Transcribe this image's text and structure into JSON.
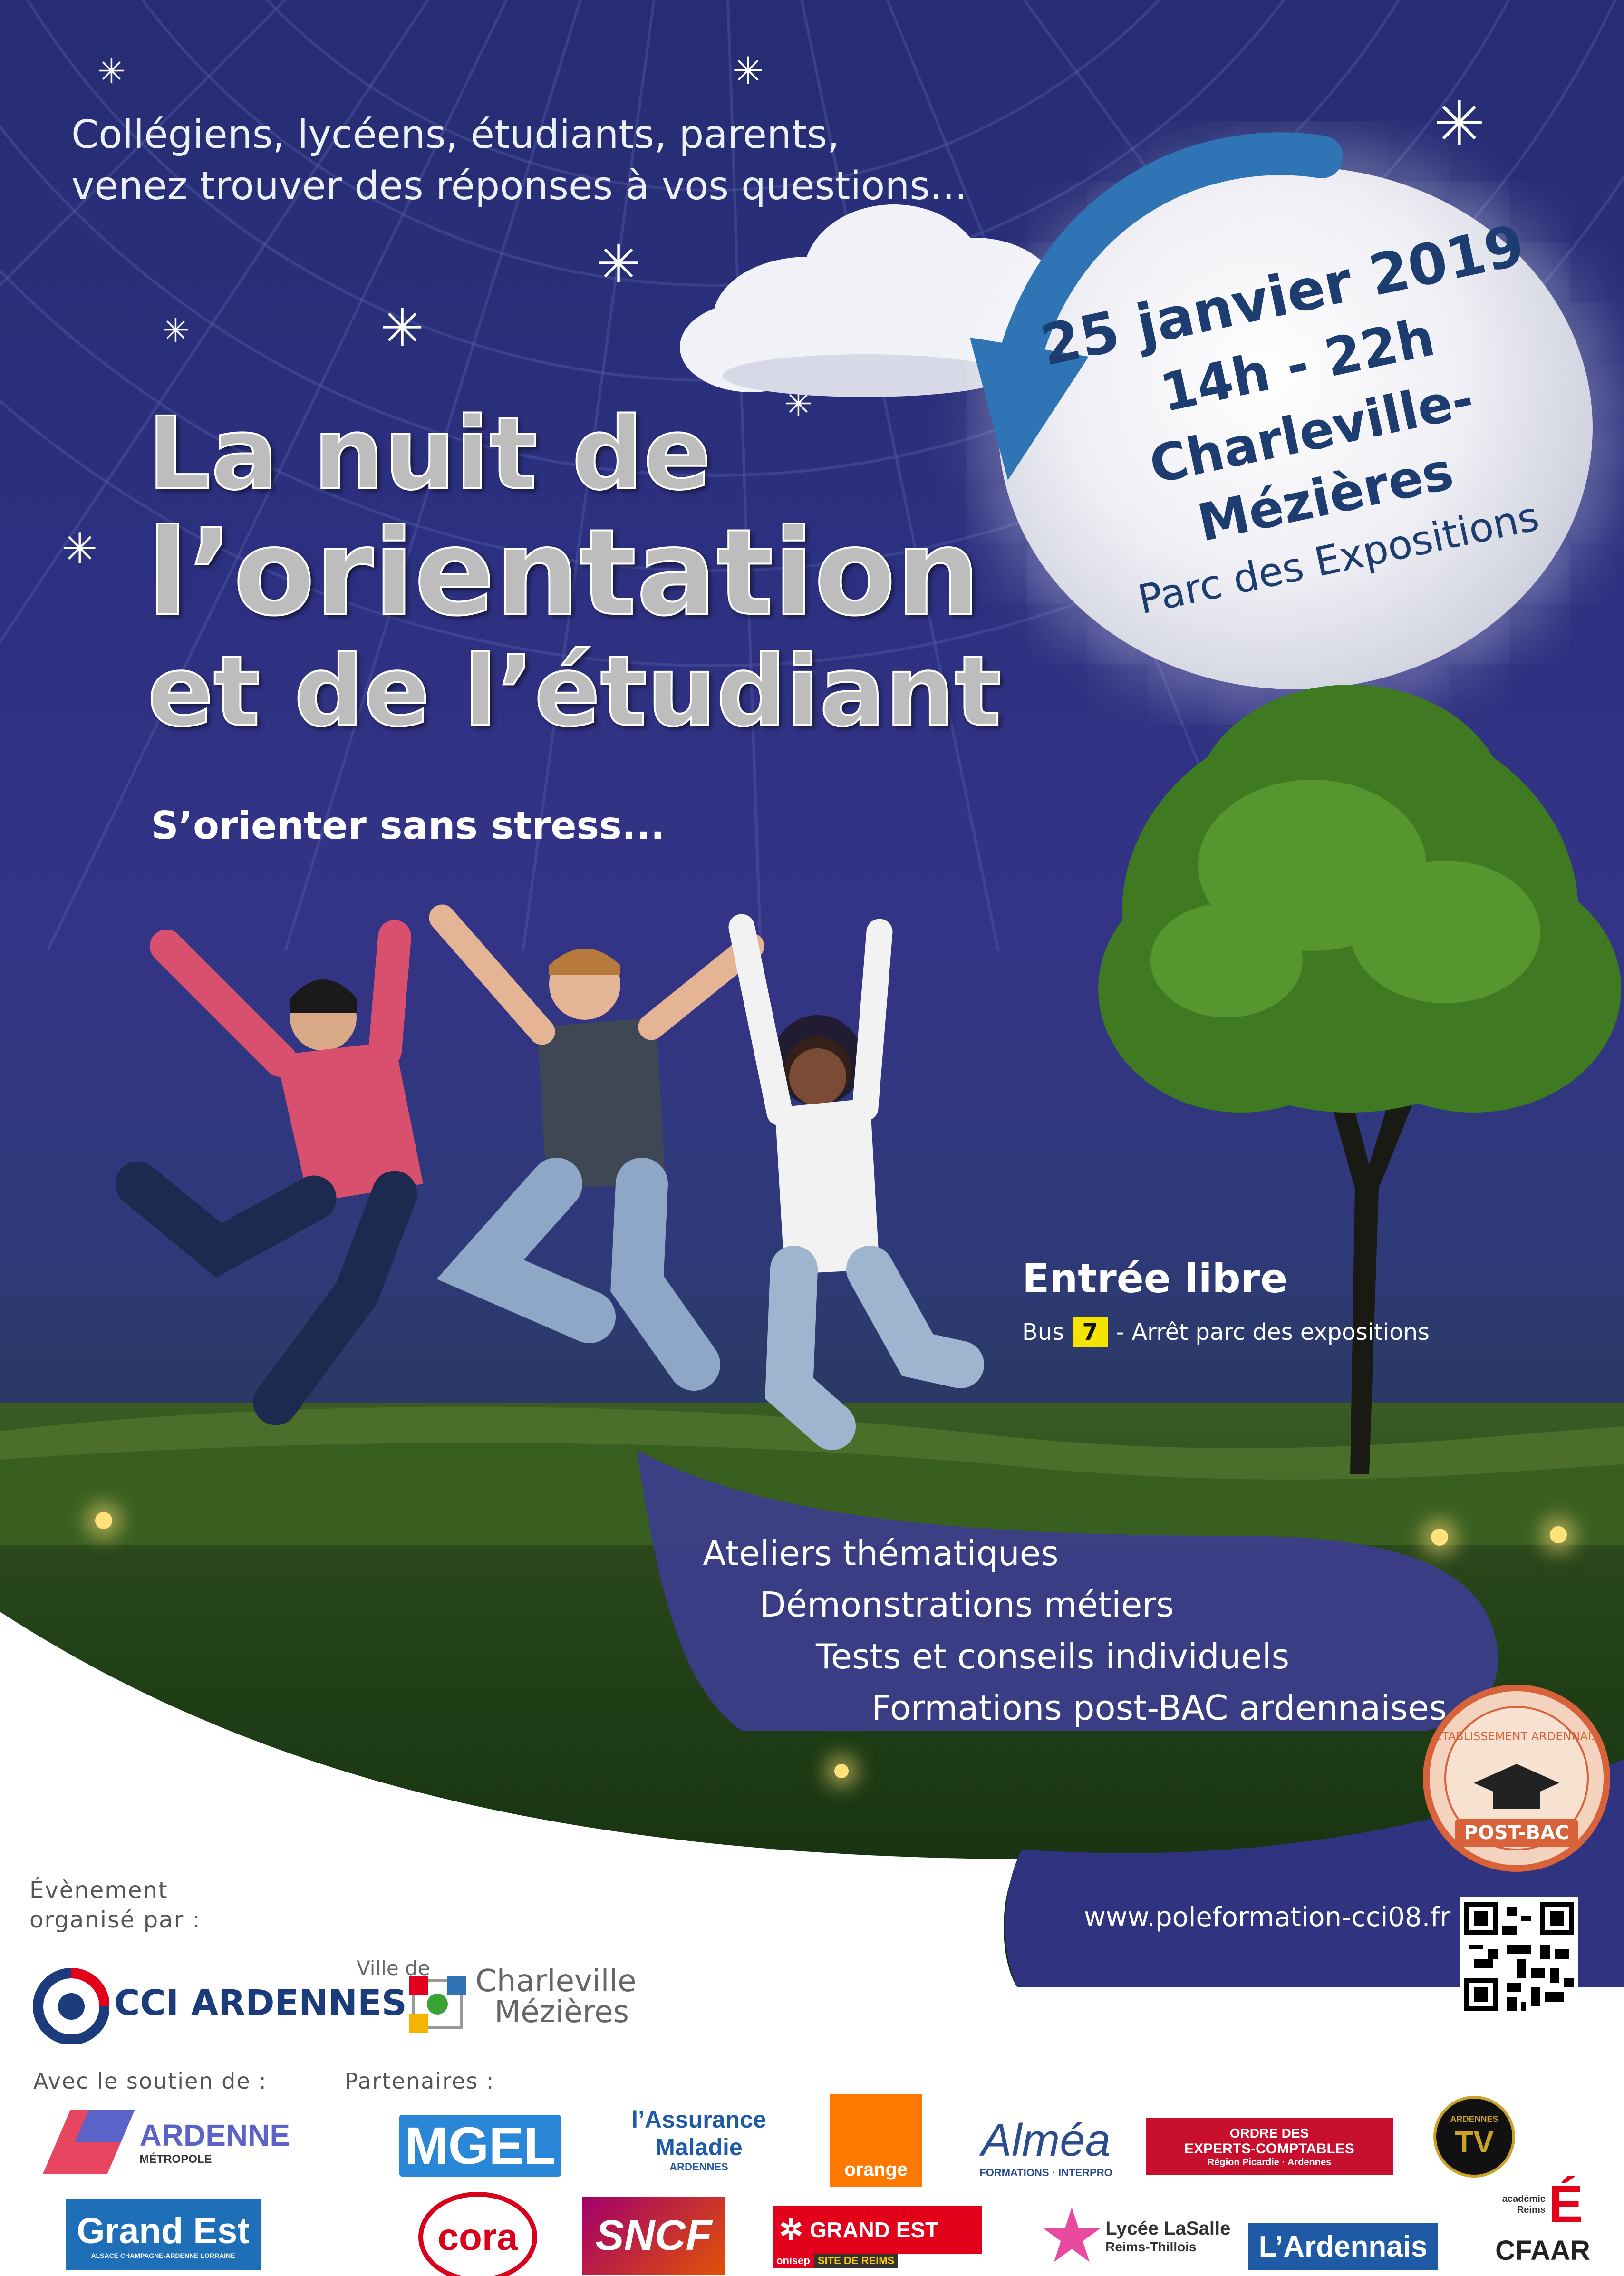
{
  "intro": {
    "line1": "Collégiens, lycéens, étudiants, parents,",
    "line2": "venez trouver des réponses à vos questions..."
  },
  "title": {
    "line1": "La nuit de",
    "line2": "l’orientation",
    "line3": "et de l’étudiant"
  },
  "tagline": "S’orienter sans stress...",
  "event": {
    "date": "25 janvier 2019",
    "hours": "14h - 22h",
    "city": "Charleville-Mézières",
    "venue": "Parc des Expositions"
  },
  "access": {
    "entry": "Entrée libre",
    "bus_prefix": "Bus",
    "bus_number": "7",
    "bus_suffix": "- Arrêt parc des expositions"
  },
  "activities": [
    "Ateliers thématiques",
    "Démonstrations métiers",
    "Tests et conseils individuels",
    "Formations post-BAC ardennaises"
  ],
  "badge": {
    "top": "ÉTABLISSEMENT ARDENNAIS",
    "bottom": "POST-BAC"
  },
  "website": "www.poleformation-cci08.fr",
  "organizer": {
    "label_line1": "Évènement",
    "label_line2": "organisé par :",
    "cci": "CCI ARDENNES",
    "ville_prefix": "Ville de",
    "ville_line1": "Charleville",
    "ville_line2": "Mézières"
  },
  "support_label": "Avec le soutien de :",
  "partners_label": "Partenaires :",
  "logos": {
    "ardenne": "ARDENNE",
    "ardenne_sub": "MÉTROPOLE",
    "grandest": "Grand Est",
    "grandest_sub": "ALSACE CHAMPAGNE-ARDENNE LORRAINE",
    "mgel": "MGEL",
    "cora": "cora",
    "assurance_line1": "l’Assurance",
    "assurance_line2": "Maladie",
    "assurance_sub": "ARDENNES",
    "sncf": "SNCF",
    "orange": "orange",
    "onisep_line1": "GRAND EST",
    "onisep_sub": "onisep",
    "onisep_sub2": "SITE DE REIMS",
    "almea": "Alméa",
    "almea_sub": "FORMATIONS · INTERPRO",
    "lasalle_line1": "Lycée LaSalle",
    "lasalle_line2": "Reims-Thillois",
    "experts_line1": "ORDRE DES",
    "experts_line2": "EXPERTS-COMPTABLES",
    "experts_sub": "Région Picardie · Ardennes",
    "lardennais": "L’Ardennais",
    "ardennestv_top": "ARDENNES",
    "ardennestv": "TV",
    "academie_line1": "académie",
    "academie_line2": "Reims",
    "cfaar": "CFAAR"
  },
  "colors": {
    "sky": "#2c3080",
    "moon_text": "#1d3d70",
    "banner": "#3b3d8a",
    "bus_badge": "#f4e400",
    "cci_blue": "#1c3b7a"
  }
}
